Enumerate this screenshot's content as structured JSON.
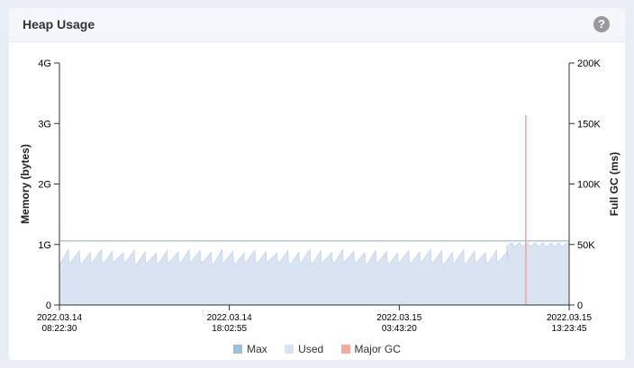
{
  "panel": {
    "title": "Heap Usage",
    "help_icon": "?"
  },
  "colors": {
    "max": "#9ebed8",
    "used": "#d9e3f2",
    "used_stroke": "#b9cde6",
    "major_gc": "#f4a99c"
  },
  "chart_data": {
    "type": "area",
    "title": "",
    "y_left": {
      "label": "Memory (bytes)",
      "ticks": [
        0,
        1,
        2,
        3,
        4
      ],
      "tick_labels": [
        "0",
        "1G",
        "2G",
        "3G",
        "4G"
      ],
      "range": [
        0,
        4
      ],
      "unit": "G"
    },
    "y_right": {
      "label": "Full GC (ms)",
      "ticks": [
        0,
        50000,
        100000,
        150000,
        200000
      ],
      "tick_labels": [
        "0",
        "50K",
        "100K",
        "150K",
        "200K"
      ],
      "range": [
        0,
        200000
      ]
    },
    "x_ticks": [
      {
        "date": "2022.03.14",
        "time": "08:22:30"
      },
      {
        "date": "2022.03.14",
        "time": "18:02:55"
      },
      {
        "date": "2022.03.15",
        "time": "03:43:20"
      },
      {
        "date": "2022.03.15",
        "time": "13:23:45"
      }
    ],
    "x_range_hours": [
      0,
      29.02
    ],
    "series": [
      {
        "name": "Max",
        "values_constant": 1.06
      },
      {
        "name": "Used",
        "sawtooth": {
          "low": 0.66,
          "high": 0.92,
          "period_hours": 0.625,
          "end_hours": 25.45,
          "after_high": 1.03,
          "after_low": 0.96
        }
      },
      {
        "name": "Major GC",
        "events": [
          {
            "hour": 26.55,
            "value": 157000
          }
        ]
      }
    ],
    "legend": [
      "Max",
      "Used",
      "Major GC"
    ],
    "legend_position": "bottom",
    "grid": false
  }
}
